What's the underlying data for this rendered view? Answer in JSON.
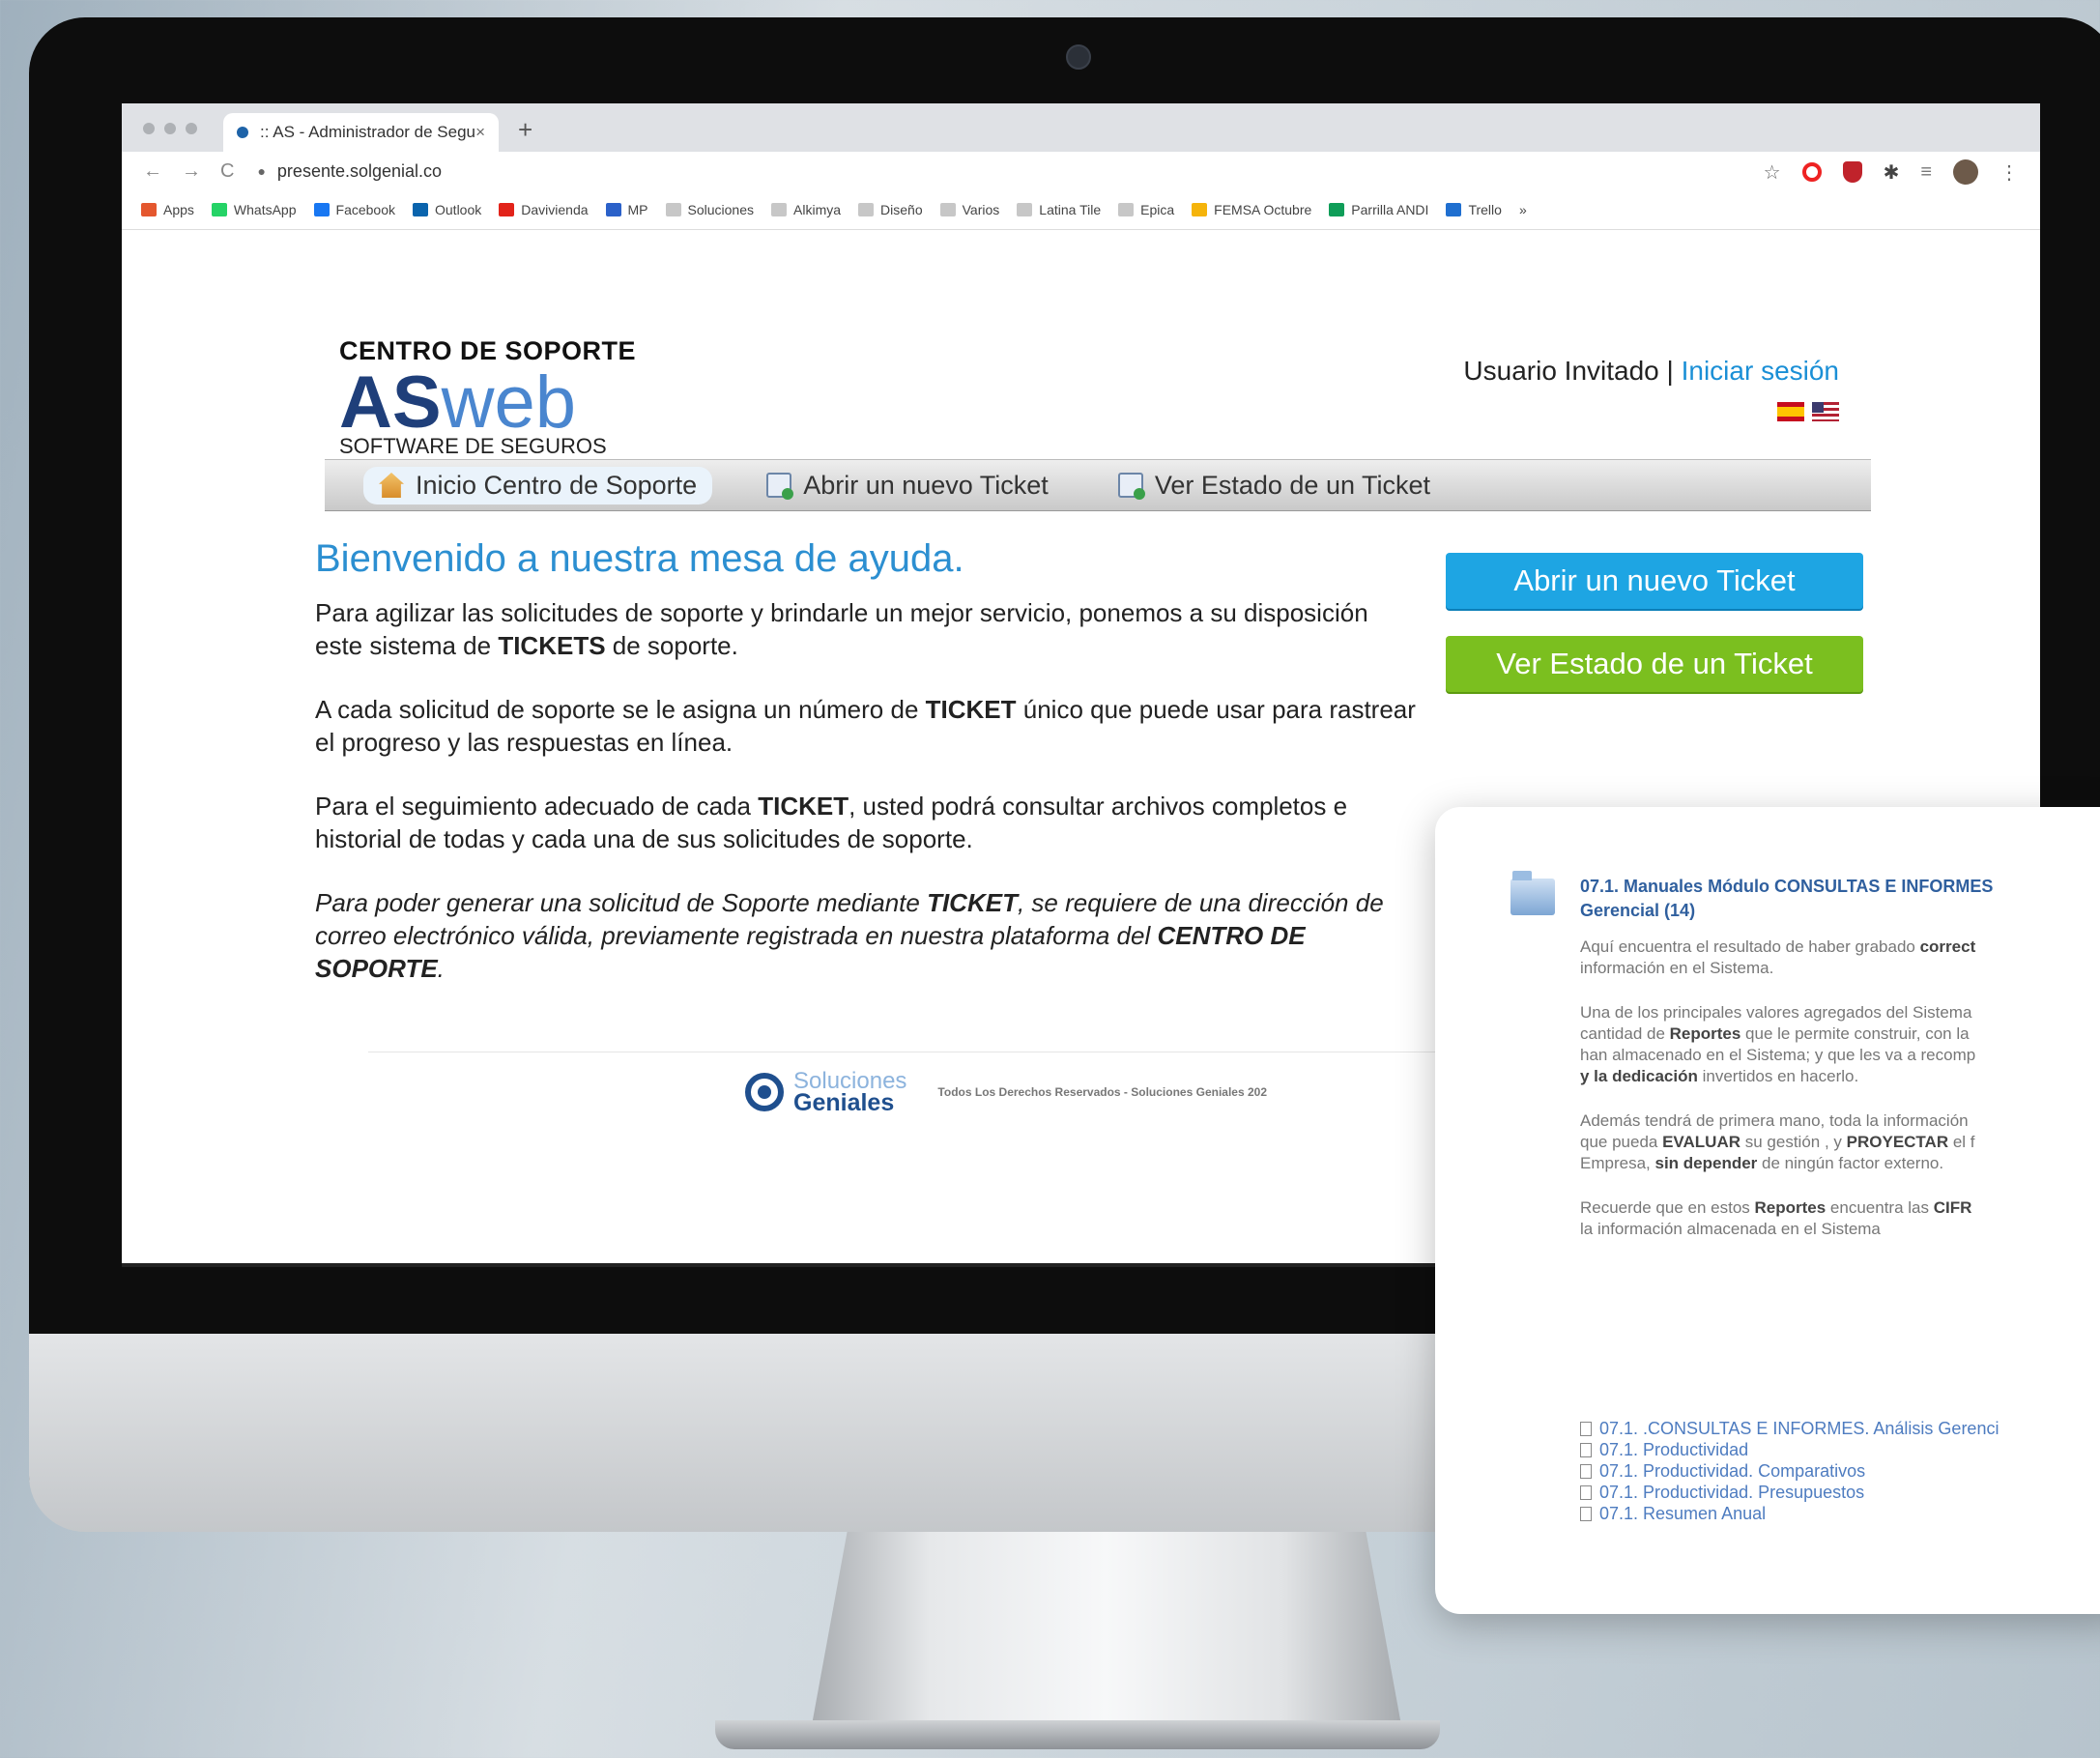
{
  "browser": {
    "tab_title": ":: AS - Administrador de Segu",
    "tab_close": "×",
    "new_tab": "+",
    "nav_back": "←",
    "nav_forward": "→",
    "nav_reload": "C",
    "url": "presente.solgenial.co",
    "bookmarks": [
      {
        "label": "Apps",
        "color": "#e4572e"
      },
      {
        "label": "WhatsApp",
        "color": "#25d366"
      },
      {
        "label": "Facebook",
        "color": "#1877f2"
      },
      {
        "label": "Outlook",
        "color": "#0a64ad"
      },
      {
        "label": "Davivienda",
        "color": "#e2231a"
      },
      {
        "label": "MP",
        "color": "#2b61c9"
      },
      {
        "label": "Soluciones",
        "color": "folder"
      },
      {
        "label": "Alkimya",
        "color": "folder"
      },
      {
        "label": "Diseño",
        "color": "folder"
      },
      {
        "label": "Varios",
        "color": "folder"
      },
      {
        "label": "Latina Tile",
        "color": "folder"
      },
      {
        "label": "Epica",
        "color": "folder"
      },
      {
        "label": "FEMSA Octubre",
        "color": "#f5b40b"
      },
      {
        "label": "Parrilla ANDI",
        "color": "#0f9d58"
      },
      {
        "label": "Trello",
        "color": "#1f6fd0"
      }
    ],
    "more": "»"
  },
  "header": {
    "logo_line1": "CENTRO DE SOPORTE",
    "logo_as": "AS",
    "logo_web": "web",
    "logo_line3": "SOFTWARE DE SEGUROS",
    "user_text": "Usuario Invitado | ",
    "login_link": "Iniciar sesión"
  },
  "nav": {
    "home": "Inicio Centro de Soporte",
    "open_ticket": "Abrir un nuevo Ticket",
    "ticket_status": "Ver Estado de un Ticket"
  },
  "main": {
    "heading": "Bienvenido a nuestra mesa de ayuda.",
    "p1a": "Para agilizar las solicitudes de soporte y brindarle un mejor servicio, ponemos a su disposición este sistema de ",
    "p1b": "TICKETS",
    "p1c": " de soporte.",
    "p2a": "A cada solicitud de soporte se le asigna un número de ",
    "p2b": "TICKET",
    "p2c": " único que puede usar para rastrear el progreso y las respuestas en línea.",
    "p3a": "Para el seguimiento adecuado de cada ",
    "p3b": "TICKET",
    "p3c": ", usted podrá consultar archivos completos e historial de todas y cada una de sus solicitudes de soporte.",
    "p4a": "Para poder generar una solicitud de Soporte mediante ",
    "p4b": "TICKET",
    "p4c": ", se requiere de una dirección de correo electrónico válida, previamente registrada en nuestra plataforma del ",
    "p4d": "CENTRO DE SOPORTE",
    "p4e": ".",
    "btn_open": "Abrir un nuevo Ticket",
    "btn_status": "Ver Estado de un Ticket"
  },
  "footer": {
    "brand1": "Soluciones",
    "brand2": "Geniales",
    "copyright": "Todos Los Derechos Reservados - Soluciones Geniales 202"
  },
  "card": {
    "title1": "07.1. Manuales Módulo CONSULTAS E INFORMES",
    "title2": "Gerencial (14)",
    "p1a": "Aquí encuentra el resultado de haber grabado ",
    "p1b": "correct",
    "p1c": "información en el Sistema.",
    "p2a": "Una de los principales valores agregados del Sistema",
    "p2b": "cantidad de ",
    "p2c": "Reportes",
    "p2d": " que le permite construir, con la",
    "p2e": "han almacenado en el Sistema; y que les va a recomp",
    "p2f": "y la dedicación",
    "p2g": " invertidos en hacerlo.",
    "p3a": "Además tendrá de primera mano, toda la información",
    "p3b": "que pueda ",
    "p3c": "EVALUAR",
    "p3d": " su gestión , y ",
    "p3e": "PROYECTAR",
    "p3f": " el f",
    "p3g": "Empresa, ",
    "p3h": "sin depender",
    "p3i": " de ningún factor externo.",
    "p4a": "Recuerde que en estos ",
    "p4b": "Reportes",
    "p4c": " encuentra las ",
    "p4d": "CIFR",
    "p4e": "la información almacenada en el Sistema",
    "files": [
      "07.1. .CONSULTAS E INFORMES. Análisis Gerenci",
      "07.1. Productividad",
      "07.1. Productividad. Comparativos",
      "07.1. Productividad. Presupuestos",
      "07.1. Resumen Anual"
    ]
  }
}
